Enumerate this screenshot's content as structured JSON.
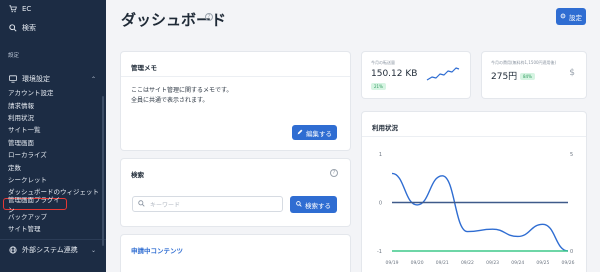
{
  "sidebar": {
    "top_item": "EC",
    "search": "検索",
    "section_label": "設定",
    "group": "環境設定",
    "sub_items": [
      "アカウント設定",
      "請求情報",
      "利用状況",
      "サイト一覧",
      "管理画面",
      "ローカライズ",
      "定数",
      "シークレット",
      "ダッシュボードのウィジェット",
      "管理画面プラグイン",
      "バックアップ",
      "サイト管理"
    ],
    "active_index": 9,
    "external": "外部システム連携"
  },
  "header": {
    "title": "ダッシュボード",
    "settings_label": "設定"
  },
  "memo": {
    "title": "管理メモ",
    "line1": "ここはサイト管理に関するメモです。",
    "line2": "全員に共通で表示されます。",
    "edit_label": "編集する"
  },
  "search": {
    "title": "検索",
    "placeholder": "キーワード",
    "button_label": "検索する"
  },
  "pending": {
    "title": "申請中コンテンツ"
  },
  "stats": {
    "transfer_label": "今月の転送量",
    "transfer_value": "150.12 KB",
    "transfer_badge": "21%",
    "cost_label": "今月の費用(無料枠1,1500円適用後)",
    "cost_value": "275円",
    "cost_badge": "84%"
  },
  "usage": {
    "title": "利用状況"
  },
  "chart_data": {
    "type": "line",
    "x": [
      "09/19",
      "09/20",
      "09/21",
      "09/22",
      "09/23",
      "09/24",
      "09/25",
      "09/26"
    ],
    "y_left_ticks": [
      "1",
      "0",
      "-1"
    ],
    "y_right_ticks": [
      "5",
      "0"
    ],
    "ylim": [
      -1,
      1
    ],
    "series": [
      {
        "color": "#2f6dd2",
        "values": [
          0.6,
          -0.05,
          0.55,
          -0.6,
          -0.55,
          -0.7,
          -0.45,
          -1
        ]
      },
      {
        "color": "#3f5a8a",
        "values": [
          0,
          0,
          0,
          0,
          0,
          0,
          0,
          0
        ]
      },
      {
        "color": "#3ec98a",
        "values": [
          -1,
          -1,
          -1,
          -1,
          -1,
          -1,
          -1,
          -1
        ]
      }
    ]
  },
  "colors": {
    "sidebar_bg": "#1c2c44",
    "accent": "#2f6dd2",
    "active_outline": "#e53935"
  }
}
